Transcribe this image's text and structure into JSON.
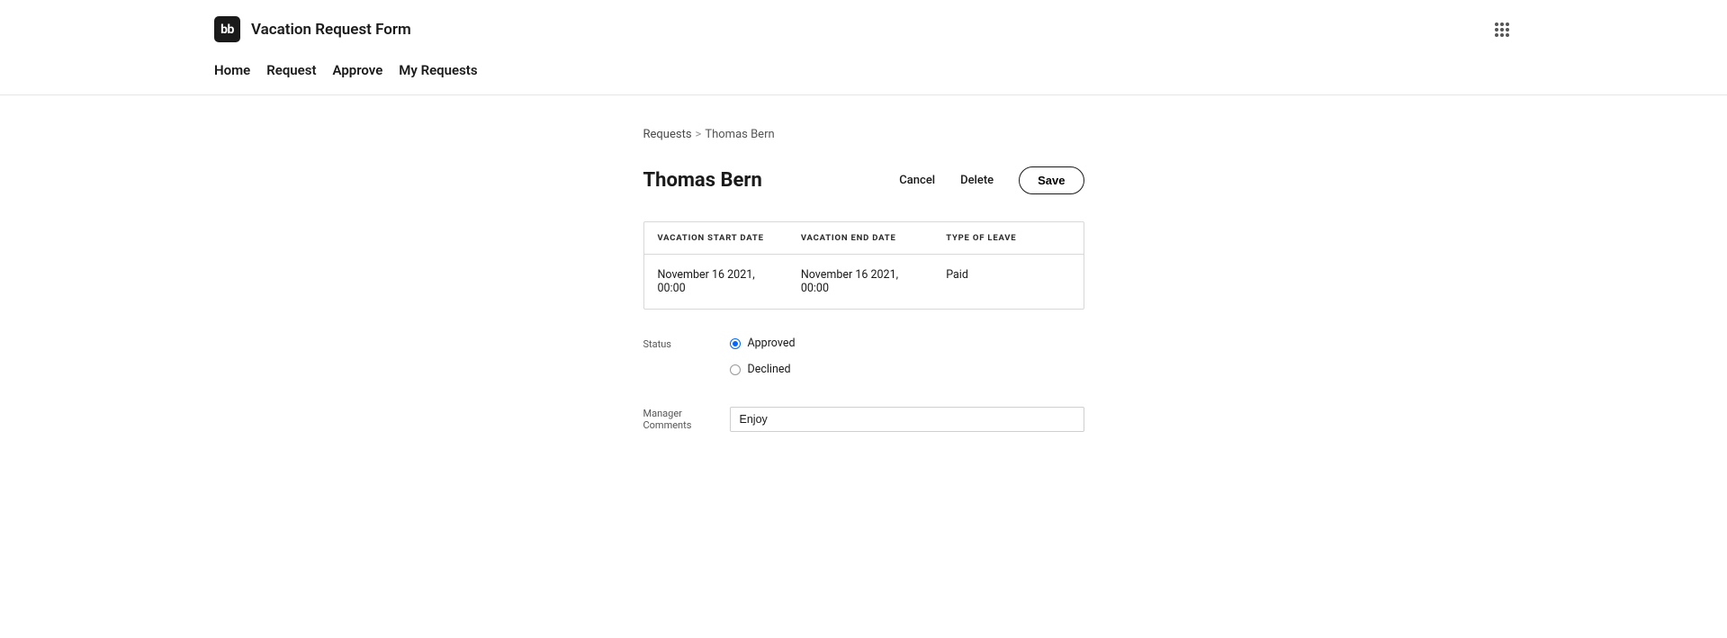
{
  "header": {
    "logo_text": "bb",
    "app_title": "Vacation Request Form"
  },
  "nav": {
    "items": [
      "Home",
      "Request",
      "Approve",
      "My Requests"
    ]
  },
  "breadcrumb": {
    "link": "Requests",
    "separator": ">",
    "current": "Thomas Bern"
  },
  "page": {
    "title": "Thomas Bern"
  },
  "actions": {
    "cancel": "Cancel",
    "delete": "Delete",
    "save": "Save"
  },
  "table": {
    "headers": {
      "start": "VACATION START DATE",
      "end": "VACATION END DATE",
      "type": "TYPE OF LEAVE"
    },
    "row": {
      "start": "November 16 2021, 00:00",
      "end": "November 16 2021, 00:00",
      "type": "Paid"
    }
  },
  "status": {
    "label": "Status",
    "options": {
      "approved": "Approved",
      "declined": "Declined"
    },
    "selected": "approved"
  },
  "comments": {
    "label": "Manager Comments",
    "value": "Enjoy"
  }
}
